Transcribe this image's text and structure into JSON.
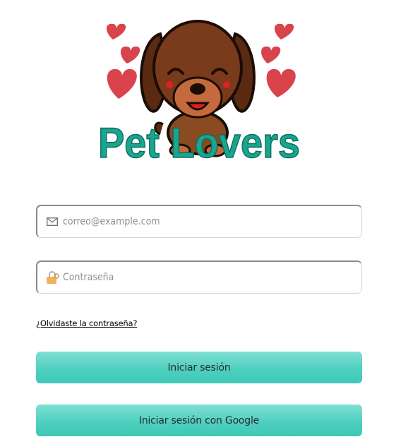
{
  "logo": {
    "text": "Pet Lovers",
    "brand_color": "#1aa58f",
    "heart_color": "#d9434b",
    "dog_color": "#7a3a1c"
  },
  "form": {
    "email": {
      "placeholder": "correo@example.com",
      "value": "",
      "icon": "envelope-icon"
    },
    "password": {
      "placeholder": "Contraseña",
      "value": "",
      "icon": "lock-icon"
    },
    "forgot_link": "¿Olvidaste la contraseña?",
    "login_button": "Iniciar sesión",
    "google_button": "Iniciar sesión con Google",
    "button_color": "#4fd0c0"
  }
}
